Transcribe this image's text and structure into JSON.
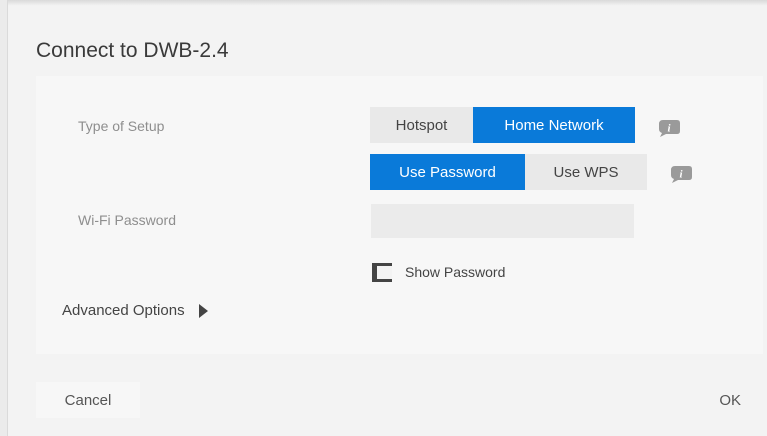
{
  "dialog": {
    "title": "Connect to DWB-2.4",
    "type_of_setup": {
      "label": "Type of Setup",
      "options": [
        "Hotspot",
        "Home Network"
      ],
      "selected": "Home Network"
    },
    "security": {
      "options": [
        "Use Password",
        "Use WPS"
      ],
      "selected": "Use Password"
    },
    "wifi_password": {
      "label": "Wi-Fi Password",
      "value": ""
    },
    "show_password": {
      "label": "Show Password",
      "checked": false
    },
    "advanced_options": "Advanced Options",
    "buttons": {
      "cancel": "Cancel",
      "ok": "OK"
    }
  },
  "colors": {
    "accent": "#0a7ad9",
    "background": "#f3f3f3",
    "panel": "#f7f7f7",
    "segment_off": "#e9e9e9",
    "info_icon": "#999999"
  },
  "icons": [
    "info-icon",
    "info-icon",
    "checkbox-icon",
    "caret-right-icon"
  ]
}
